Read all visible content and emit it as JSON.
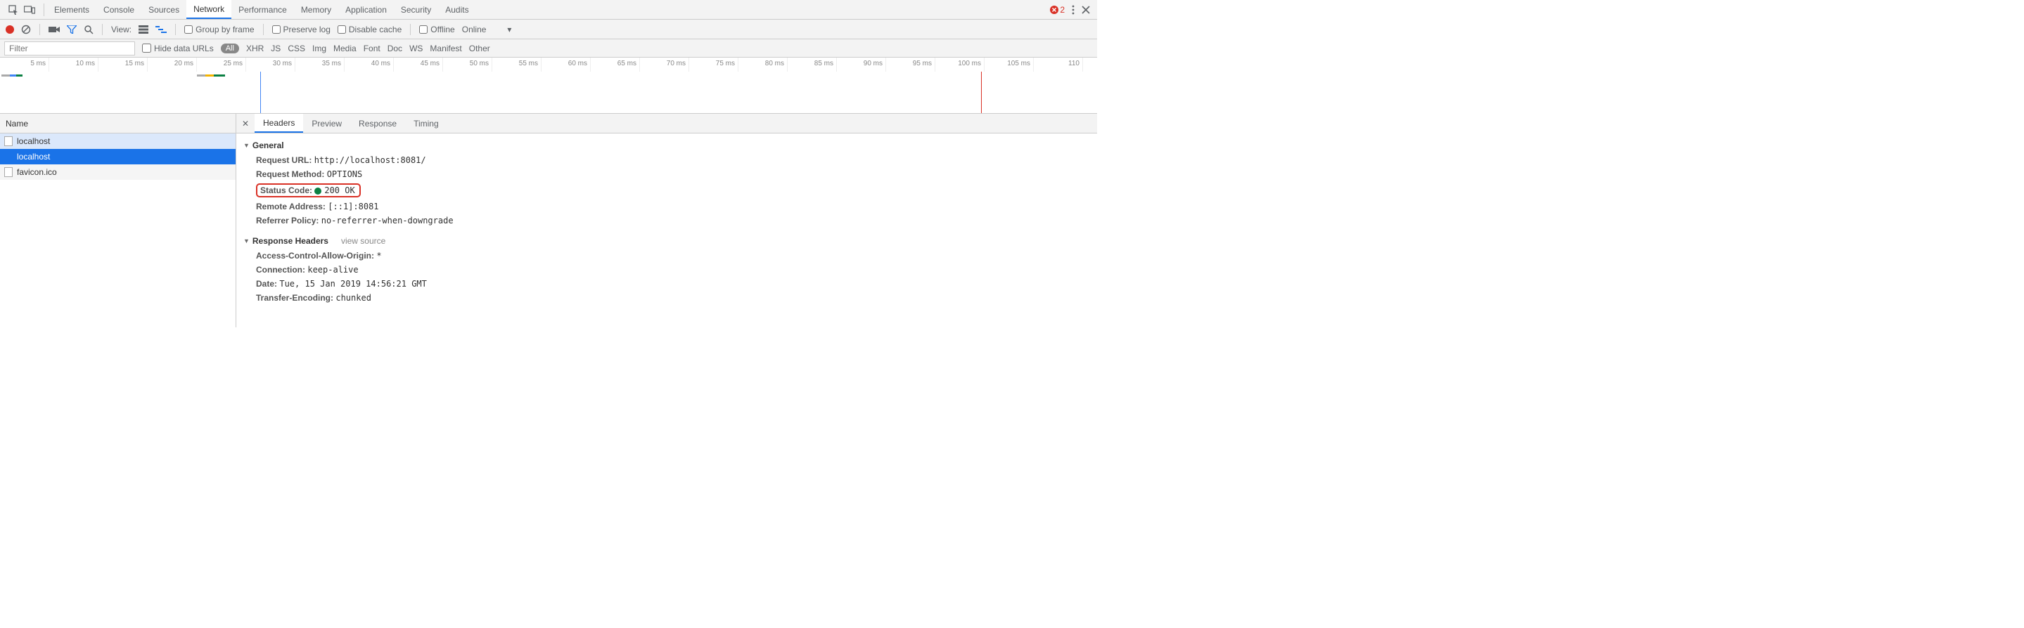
{
  "topTabs": {
    "items": [
      "Elements",
      "Console",
      "Sources",
      "Network",
      "Performance",
      "Memory",
      "Application",
      "Security",
      "Audits"
    ],
    "active": "Network",
    "errorCount": "2"
  },
  "toolbar": {
    "viewLabel": "View:",
    "groupByFrame": "Group by frame",
    "preserveLog": "Preserve log",
    "disableCache": "Disable cache",
    "offline": "Offline",
    "throttle": "Online"
  },
  "filterRow": {
    "placeholder": "Filter",
    "hideDataUrls": "Hide data URLs",
    "all": "All",
    "types": [
      "XHR",
      "JS",
      "CSS",
      "Img",
      "Media",
      "Font",
      "Doc",
      "WS",
      "Manifest",
      "Other"
    ]
  },
  "timeline": {
    "ticks": [
      "5 ms",
      "10 ms",
      "15 ms",
      "20 ms",
      "25 ms",
      "30 ms",
      "35 ms",
      "40 ms",
      "45 ms",
      "50 ms",
      "55 ms",
      "60 ms",
      "65 ms",
      "70 ms",
      "75 ms",
      "80 ms",
      "85 ms",
      "90 ms",
      "95 ms",
      "100 ms",
      "105 ms",
      "110"
    ]
  },
  "requestList": {
    "header": "Name",
    "items": [
      {
        "name": "localhost"
      },
      {
        "name": "localhost"
      },
      {
        "name": "favicon.ico"
      }
    ]
  },
  "detailTabs": {
    "items": [
      "Headers",
      "Preview",
      "Response",
      "Timing"
    ],
    "active": "Headers"
  },
  "headers": {
    "generalTitle": "General",
    "requestUrl": {
      "k": "Request URL:",
      "v": "http://localhost:8081/"
    },
    "requestMethod": {
      "k": "Request Method:",
      "v": "OPTIONS"
    },
    "statusCode": {
      "k": "Status Code:",
      "v": "200 OK"
    },
    "remoteAddress": {
      "k": "Remote Address:",
      "v": "[::1]:8081"
    },
    "referrerPolicy": {
      "k": "Referrer Policy:",
      "v": "no-referrer-when-downgrade"
    },
    "responseHeadersTitle": "Response Headers",
    "viewSource": "view source",
    "acao": {
      "k": "Access-Control-Allow-Origin:",
      "v": "*"
    },
    "connection": {
      "k": "Connection:",
      "v": "keep-alive"
    },
    "date": {
      "k": "Date:",
      "v": "Tue, 15 Jan 2019 14:56:21 GMT"
    },
    "transferEncoding": {
      "k": "Transfer-Encoding:",
      "v": "chunked"
    }
  }
}
